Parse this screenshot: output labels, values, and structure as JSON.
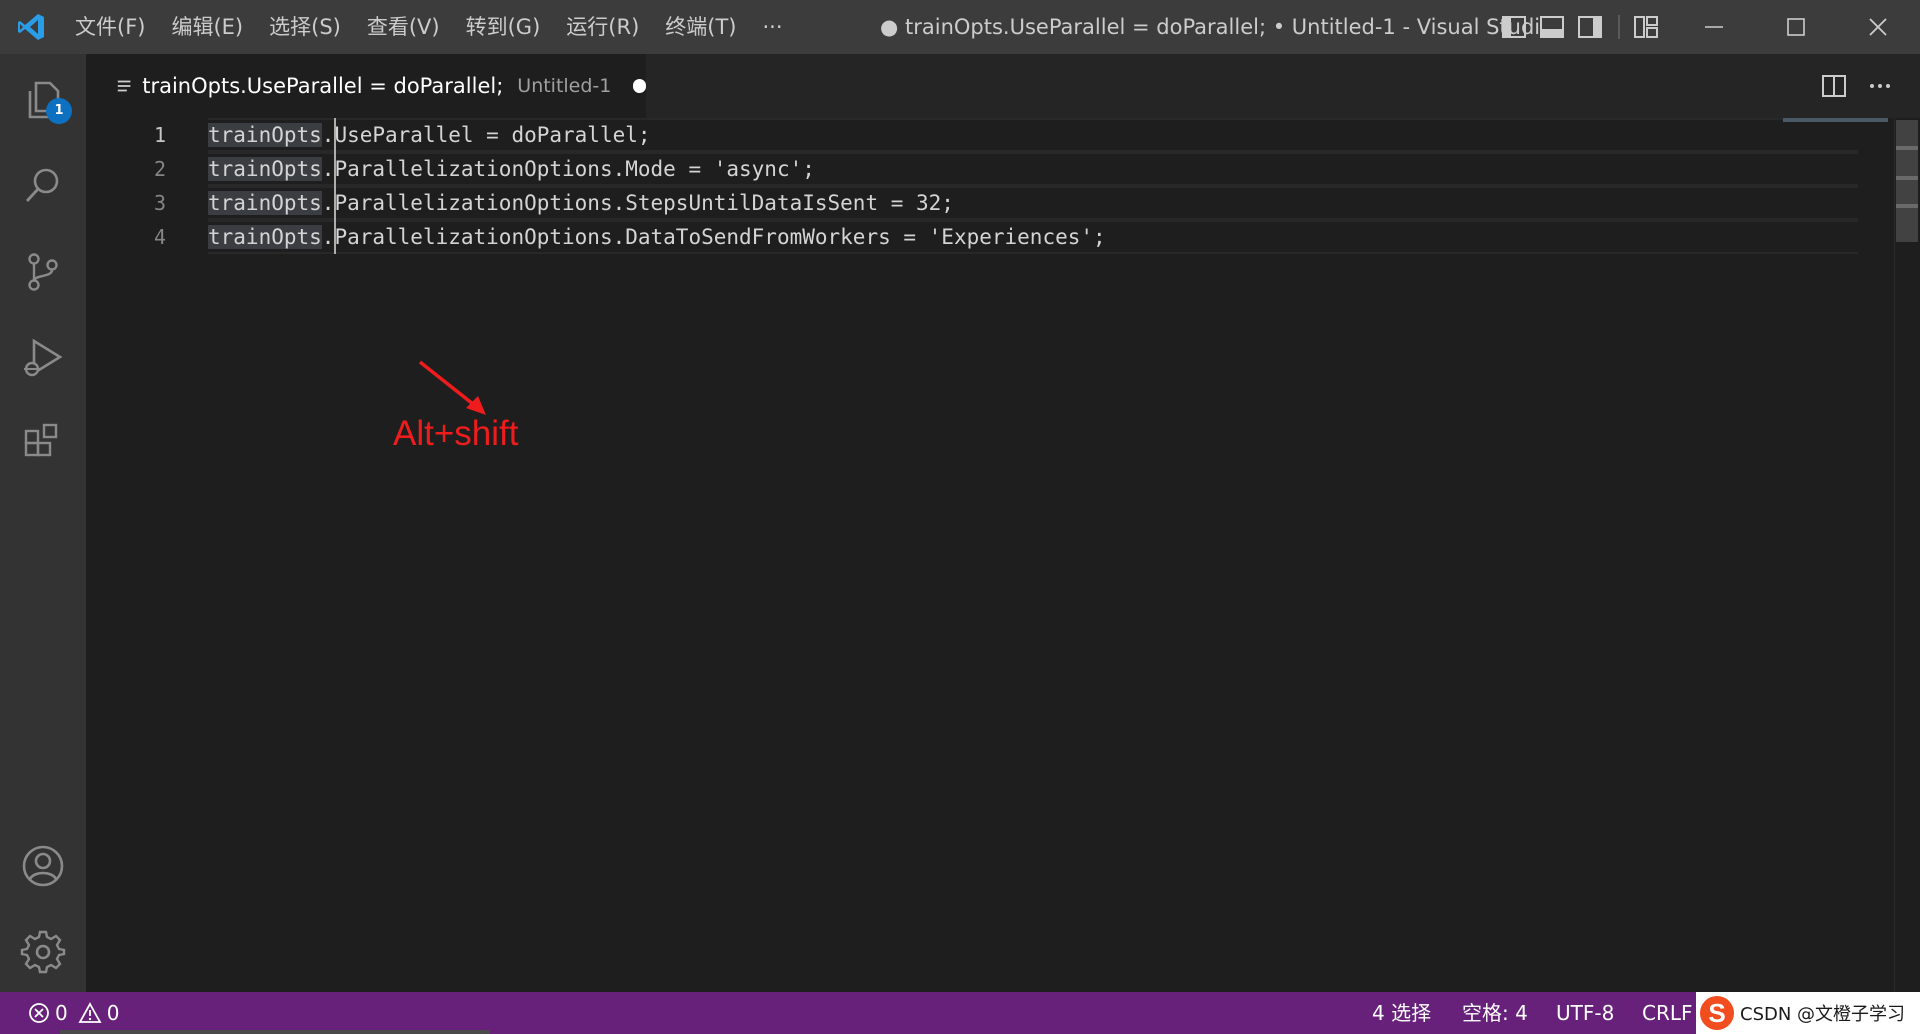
{
  "titlebar": {
    "menu": [
      "文件(F)",
      "编辑(E)",
      "选择(S)",
      "查看(V)",
      "转到(G)",
      "运行(R)",
      "终端(T)",
      "···"
    ],
    "window_title": "● trainOpts.UseParallel = doParallel; • Untitled-1 - Visual Studi...",
    "logo_icon": "vscode-logo-icon"
  },
  "activitybar": {
    "icons": [
      "files-icon",
      "search-icon",
      "source-control-icon",
      "run-debug-icon",
      "extensions-icon",
      "account-icon",
      "gear-icon"
    ],
    "explorer_badge": "1"
  },
  "tab": {
    "label": "trainOpts.UseParallel = doParallel;",
    "description": "Untitled-1"
  },
  "editor": {
    "lines": [
      {
        "number": "1",
        "prefix": "trainOpts",
        "rest": ".UseParallel = doParallel;"
      },
      {
        "number": "2",
        "prefix": "trainOpts",
        "rest": ".ParallelizationOptions.Mode = 'async';"
      },
      {
        "number": "3",
        "prefix": "trainOpts",
        "rest": ".ParallelizationOptions.StepsUntilDataIsSent = 32;"
      },
      {
        "number": "4",
        "prefix": "trainOpts",
        "rest": ".ParallelizationOptions.DataToSendFromWorkers = 'Experiences';"
      }
    ],
    "annotation": "Alt+shift",
    "annotation_color": "#ee1c1c"
  },
  "statusbar": {
    "errors": "0",
    "warnings": "0",
    "selection": "4 选择",
    "spaces": "空格: 4",
    "encoding": "UTF-8",
    "eol": "CRLF",
    "color": "#68217a"
  },
  "watermark": {
    "logo": "S",
    "text": "CSDN @文橙子学习"
  }
}
